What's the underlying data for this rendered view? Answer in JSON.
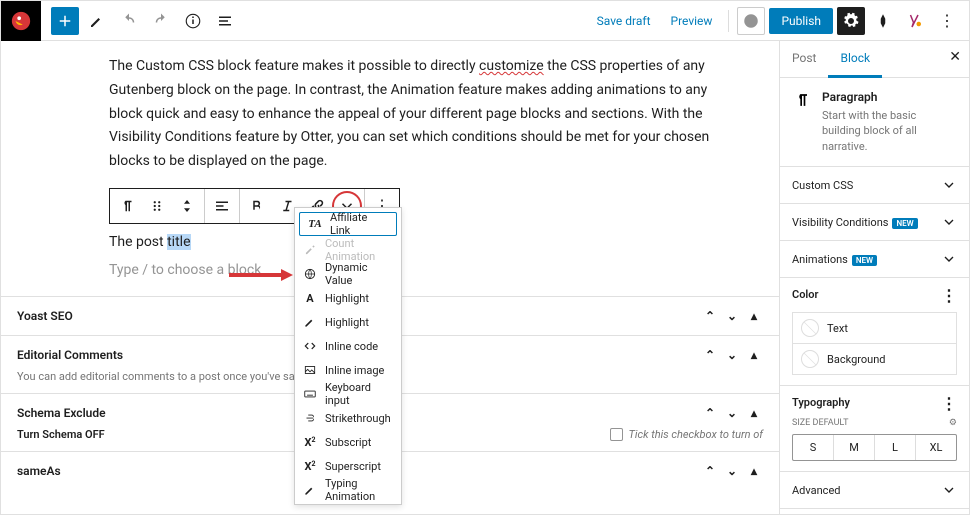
{
  "topbar": {
    "save_draft": "Save draft",
    "preview": "Preview",
    "publish": "Publish"
  },
  "content": {
    "paragraph": "The Custom CSS block feature makes it possible to directly ",
    "paragraph_underlined": "customize",
    "paragraph_rest": " the CSS properties of any Gutenberg block on the page. In contrast, the Animation feature makes adding animations to any block quick and easy to enhance the appeal of your different page blocks and sections. With the Visibility Conditions feature by Otter, you can set which conditions should be met for your chosen blocks to be displayed on the page.",
    "post_prefix": "The post ",
    "post_highlight": "title",
    "placeholder": "Type / to choose a block"
  },
  "dropdown": {
    "items": [
      {
        "label": "Affiliate Link",
        "icon": "ta",
        "first": true
      },
      {
        "label": "Count Animation",
        "icon": "brush",
        "disabled": true
      },
      {
        "label": "Dynamic Value",
        "icon": "globe"
      },
      {
        "label": "Highlight",
        "icon": "a"
      },
      {
        "label": "Highlight",
        "icon": "brush2"
      },
      {
        "label": "Inline code",
        "icon": "code"
      },
      {
        "label": "Inline image",
        "icon": "image"
      },
      {
        "label": "Keyboard input",
        "icon": "kb"
      },
      {
        "label": "Strikethrough",
        "icon": "strike"
      },
      {
        "label": "Subscript",
        "icon": "sub"
      },
      {
        "label": "Superscript",
        "icon": "sup"
      },
      {
        "label": "Typing Animation",
        "icon": "pencil"
      }
    ]
  },
  "meta": {
    "yoast": "Yoast SEO",
    "editorial": "Editorial Comments",
    "editorial_desc": "You can add editorial comments to a post once you've saved it for t",
    "schema": "Schema Exclude",
    "turn_off": "Turn Schema OFF",
    "turn_off_desc": "Tick this checkbox to turn of",
    "sameas": "sameAs"
  },
  "sidebar": {
    "tabs": {
      "post": "Post",
      "block": "Block"
    },
    "block": {
      "name": "Paragraph",
      "desc": "Start with the basic building block of all narrative."
    },
    "rows": {
      "custom_css": "Custom CSS",
      "visibility": "Visibility Conditions",
      "animations": "Animations",
      "advanced": "Advanced",
      "new_badge": "NEW"
    },
    "color": {
      "heading": "Color",
      "text": "Text",
      "background": "Background"
    },
    "typo": {
      "heading": "Typography",
      "size_label": "SIZE",
      "size_default": "DEFAULT",
      "sizes": [
        "S",
        "M",
        "L",
        "XL"
      ]
    }
  }
}
